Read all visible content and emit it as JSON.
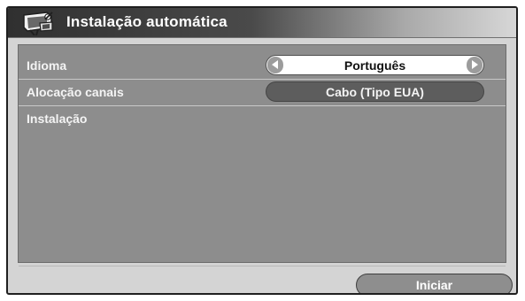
{
  "window": {
    "title": "Instalação automática",
    "icon": "tv-installation-icon"
  },
  "settings": [
    {
      "label": "Idioma",
      "value": "Português",
      "control": "stepper"
    },
    {
      "label": "Alocação canais",
      "value": "Cabo (Tipo EUA)",
      "control": "selected-option"
    },
    {
      "label": "Instalação"
    }
  ],
  "actions": {
    "start_label": "Iniciar"
  },
  "icons": {
    "left": "chevron-left-icon",
    "right": "chevron-right-icon"
  },
  "colors": {
    "title_bar_dark": "#303030",
    "title_bar_light": "#d7d7d7",
    "panel": "#8d8d8d",
    "frame": "#d4d4d4",
    "selector_background": "#ffffff",
    "selected_pill": "#5d5d5d",
    "text_light": "#ffffff",
    "text_dark": "#111111"
  }
}
